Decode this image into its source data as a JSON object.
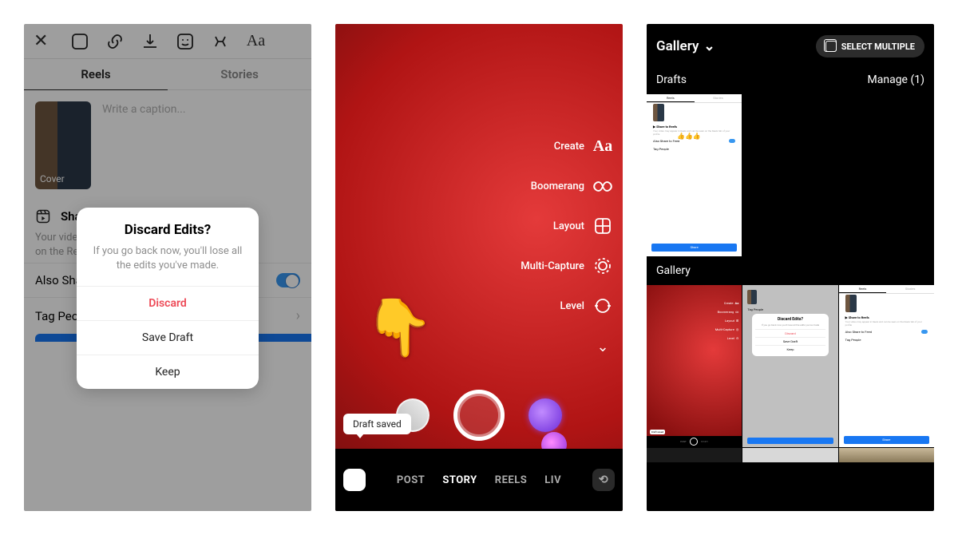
{
  "screen1": {
    "tabs": {
      "reels": "Reels",
      "stories": "Stories"
    },
    "cover_label": "Cover",
    "caption_placeholder": "Write a caption...",
    "share_header": "Share to Reels",
    "share_desc": "Your video may appear in Reels and can be seen on the Reels tab of your profile.",
    "row_also_share": "Also Share to Feed",
    "row_tag": "Tag People",
    "dialog": {
      "title": "Discard Edits?",
      "message": "If you go back now, you'll lose all the edits you've made.",
      "discard": "Discard",
      "save": "Save Draft",
      "keep": "Keep"
    }
  },
  "screen2": {
    "menu": {
      "create": "Create",
      "boomerang": "Boomerang",
      "layout": "Layout",
      "multi": "Multi-Capture",
      "level": "Level"
    },
    "toast": "Draft saved",
    "modes": {
      "post": "POST",
      "story": "STORY",
      "reels": "REELS",
      "live": "LIV"
    }
  },
  "screen3": {
    "gallery_dd": "Gallery",
    "select_multiple": "SELECT MULTIPLE",
    "drafts": "Drafts",
    "manage": "Manage (1)",
    "gallery_hdr": "Gallery",
    "mini_dialog": {
      "title": "Discard Edits?",
      "msg": "If you go back now you'll lose all the edits you've made",
      "discard": "Discard",
      "save": "Save Draft",
      "keep": "Keep"
    },
    "mini": {
      "reels": "Reels",
      "stories": "Stories",
      "share": "Share to Reels",
      "also": "Also Share to Feed",
      "tag": "Tag People",
      "share_btn": "Share",
      "draft_saved": "Draft saved",
      "create": "Create",
      "boomerang": "Boomerang",
      "layout": "Layout",
      "multi": "Multi-Capture",
      "level": "Level",
      "post": "POST",
      "story": "STORY",
      "reels_mode": "REELS"
    }
  }
}
